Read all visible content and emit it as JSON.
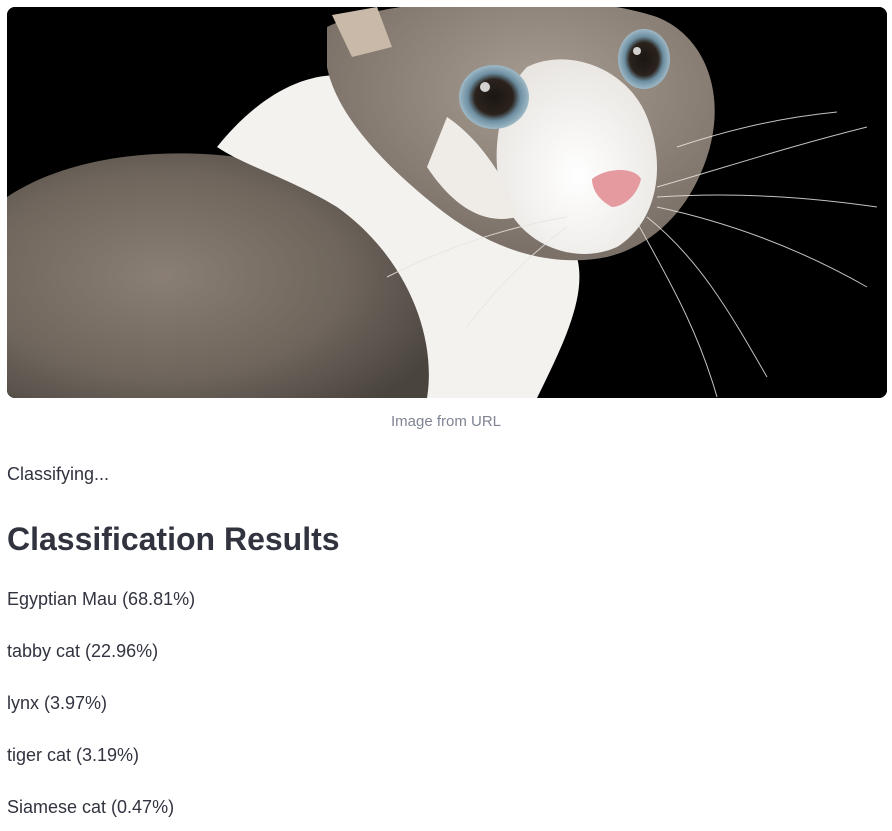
{
  "image": {
    "subject": "cat-photo",
    "caption": "Image from URL"
  },
  "status": {
    "text": "Classifying..."
  },
  "results": {
    "heading": "Classification Results",
    "items": [
      {
        "label": "Egyptian Mau (68.81%)"
      },
      {
        "label": "tabby cat (22.96%)"
      },
      {
        "label": "lynx (3.97%)"
      },
      {
        "label": "tiger cat (3.19%)"
      },
      {
        "label": "Siamese cat (0.47%)"
      }
    ]
  },
  "colors": {
    "text": "#31333f",
    "caption": "#808495",
    "photo_background": "#000000"
  }
}
